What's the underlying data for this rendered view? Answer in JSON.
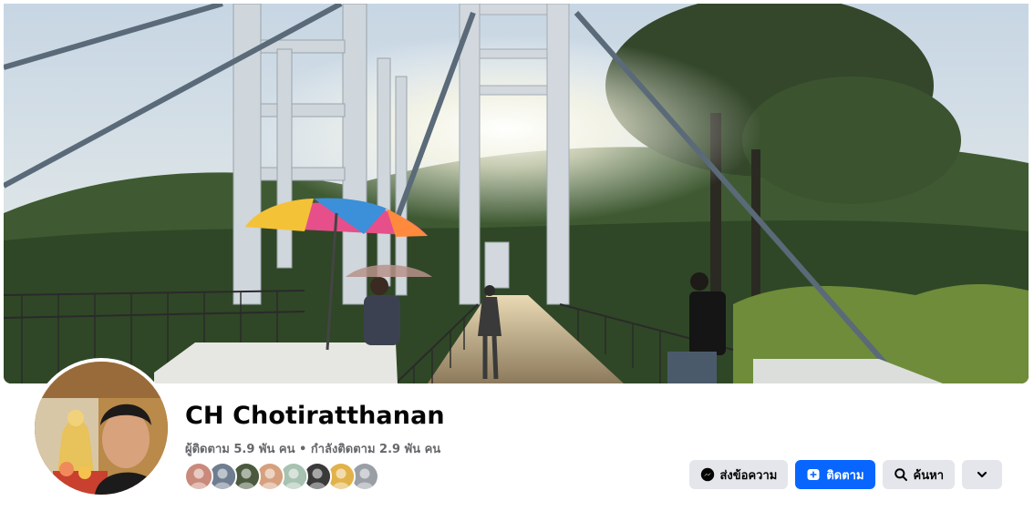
{
  "profile": {
    "name": "CH Chotiratthanan",
    "followers": "ผู้ติดตาม 5.9 พัน คน",
    "separator": " • ",
    "following": "กำลังติดตาม 2.9 พัน คน"
  },
  "friends_preview": [
    {
      "name": "friend-avatar-1",
      "color": "#c98a7b"
    },
    {
      "name": "friend-avatar-2",
      "color": "#6e7d8f"
    },
    {
      "name": "friend-avatar-3",
      "color": "#4b5a3e"
    },
    {
      "name": "friend-avatar-4",
      "color": "#d6a07f"
    },
    {
      "name": "friend-avatar-5",
      "color": "#a7c2b0"
    },
    {
      "name": "friend-avatar-6",
      "color": "#3a3a3a"
    },
    {
      "name": "friend-avatar-7",
      "color": "#e2b24a"
    },
    {
      "name": "friend-avatar-8",
      "color": "#9a9ea5"
    }
  ],
  "actions": {
    "message_label": "ส่งข้อความ",
    "follow_label": "ติดตาม",
    "search_label": "ค้นหา",
    "more_icon": "chevron-down-icon"
  },
  "colors": {
    "primary": "#0866ff",
    "secondary_button": "#e4e6eb",
    "muted_text": "#65676b"
  }
}
